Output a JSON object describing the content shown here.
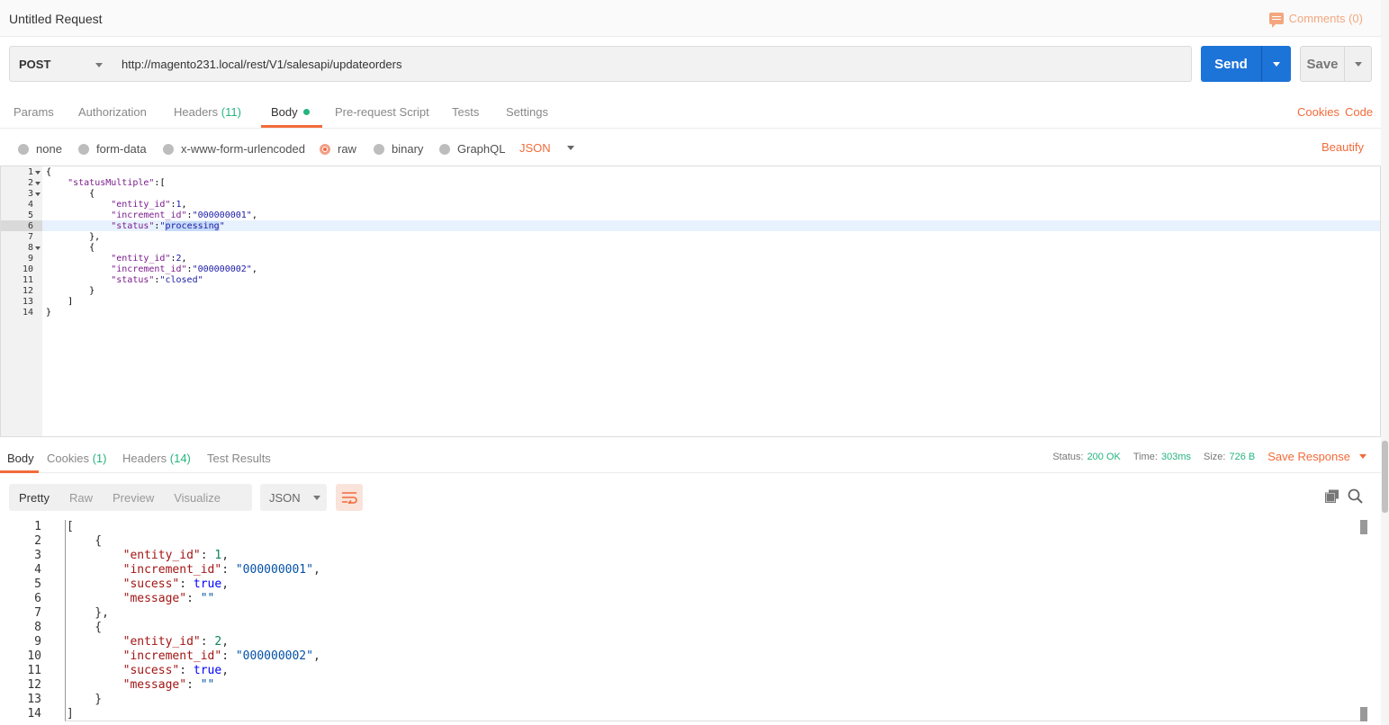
{
  "request": {
    "title": "Untitled Request",
    "comments_label": "Comments (0)",
    "method": "POST",
    "url": "http://magento231.local/rest/V1/salesapi/updateorders",
    "send_label": "Send",
    "save_label": "Save"
  },
  "request_tabs": {
    "params": "Params",
    "authorization": "Authorization",
    "headers": "Headers",
    "headers_count": "(11)",
    "body": "Body",
    "pre_request": "Pre-request Script",
    "tests": "Tests",
    "settings": "Settings",
    "cookies": "Cookies",
    "code": "Code"
  },
  "body_types": {
    "none": "none",
    "form_data": "form-data",
    "urlencoded": "x-www-form-urlencoded",
    "raw": "raw",
    "binary": "binary",
    "graphql": "GraphQL",
    "format": "JSON",
    "beautify": "Beautify",
    "selected": "raw"
  },
  "request_body": {
    "line_numbers": [
      "1",
      "2",
      "3",
      "4",
      "5",
      "6",
      "7",
      "8",
      "9",
      "10",
      "11",
      "12",
      "13",
      "14"
    ],
    "lines": [
      "{",
      "    \"statusMultiple\":[",
      "        {",
      "            \"entity_id\":1,",
      "            \"increment_id\":\"000000001\",",
      "            \"status\":\"processing\"",
      "        },",
      "        {",
      "            \"entity_id\":2,",
      "            \"increment_id\":\"000000002\",",
      "            \"status\":\"closed\"",
      "        }",
      "    ]",
      "}"
    ],
    "selected_text": "processing"
  },
  "response_tabs": {
    "body": "Body",
    "cookies": "Cookies",
    "cookies_count": "(1)",
    "headers": "Headers",
    "headers_count": "(14)",
    "test_results": "Test Results"
  },
  "response_meta": {
    "status_label": "Status:",
    "status_value": "200 OK",
    "time_label": "Time:",
    "time_value": "303ms",
    "size_label": "Size:",
    "size_value": "726 B",
    "save_response": "Save Response"
  },
  "response_view": {
    "pretty": "Pretty",
    "raw": "Raw",
    "preview": "Preview",
    "visualize": "Visualize",
    "format": "JSON"
  },
  "response_body": {
    "line_numbers": [
      "1",
      "2",
      "3",
      "4",
      "5",
      "6",
      "7",
      "8",
      "9",
      "10",
      "11",
      "12",
      "13",
      "14"
    ],
    "lines": [
      "[",
      "    {",
      "        \"entity_id\": 1,",
      "        \"increment_id\": \"000000001\",",
      "        \"sucess\": true,",
      "        \"message\": \"\"",
      "    },",
      "    {",
      "        \"entity_id\": 2,",
      "        \"increment_id\": \"000000002\",",
      "        \"sucess\": true,",
      "        \"message\": \"\"",
      "    }",
      "]"
    ]
  },
  "colors": {
    "accent": "#f26b3a",
    "send": "#1c73d8",
    "success": "#26b47f"
  }
}
